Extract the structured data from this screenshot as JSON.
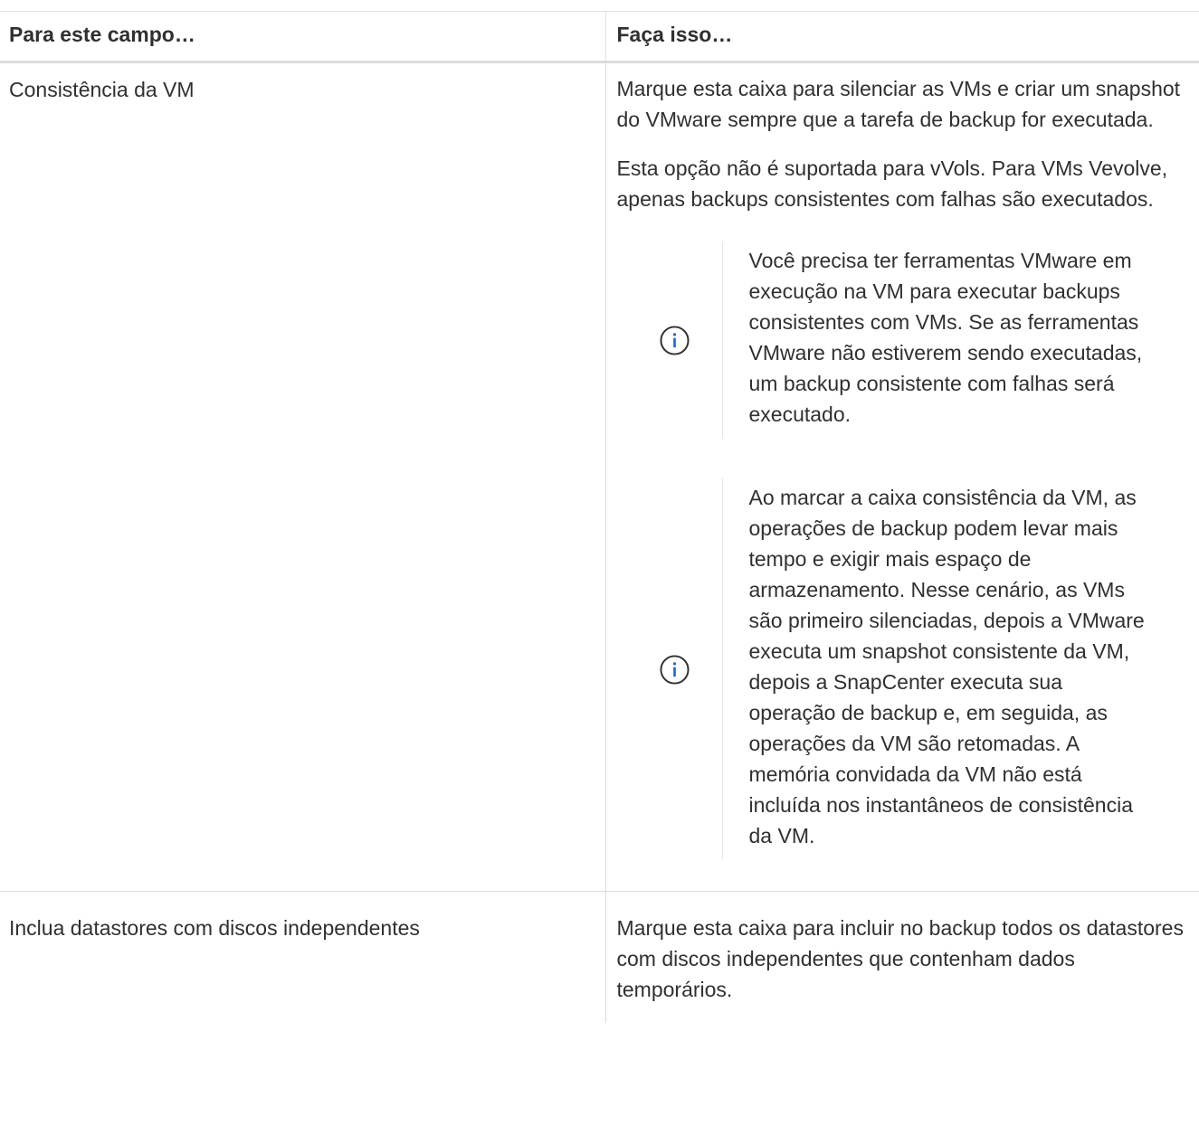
{
  "table": {
    "headers": [
      "Para este campo…",
      "Faça isso…"
    ],
    "rows": [
      {
        "field": "Consistência da VM",
        "paragraphs": [
          "Marque esta caixa para silenciar as VMs e criar um snapshot do VMware sempre que a tarefa de backup for executada.",
          "Esta opção não é suportada para vVols. Para VMs Vevolve, apenas backups consistentes com falhas são executados."
        ],
        "notes": [
          {
            "icon": "info-circle-icon",
            "text": "Você precisa ter ferramentas VMware em execução na VM para executar backups consistentes com VMs. Se as ferramentas VMware não estiverem sendo executadas, um backup consistente com falhas será executado."
          },
          {
            "icon": "info-circle-icon",
            "text": "Ao marcar a caixa consistência da VM, as operações de backup podem levar mais tempo e exigir mais espaço de armazenamento. Nesse cenário, as VMs são primeiro silenciadas, depois a VMware executa um snapshot consistente da VM, depois a SnapCenter executa sua operação de backup e, em seguida, as operações da VM são retomadas. A memória convidada da VM não está incluída nos instantâneos de consistência da VM."
          }
        ]
      },
      {
        "field": "Inclua datastores com discos independentes",
        "paragraphs": [
          "Marque esta caixa para incluir no backup todos os datastores com discos independentes que contenham dados temporários."
        ]
      }
    ]
  },
  "colors": {
    "text": "#303030",
    "icon": "#1f6bd6",
    "border": "#dddddd"
  }
}
